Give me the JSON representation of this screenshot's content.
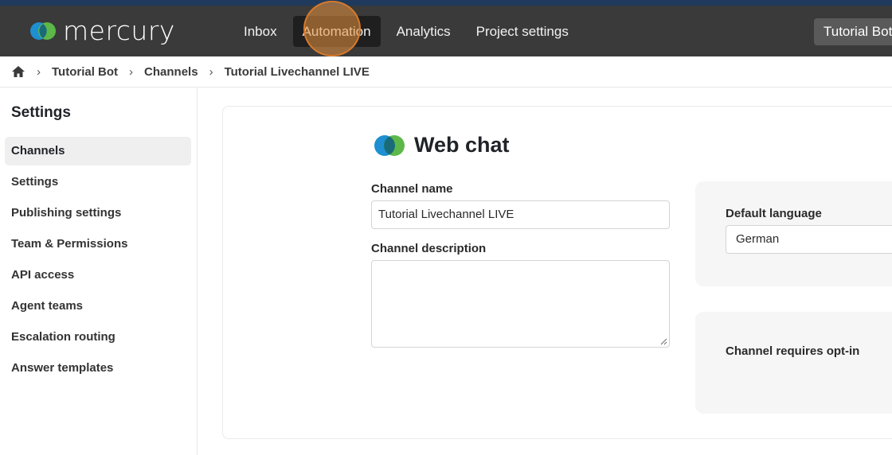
{
  "app": {
    "logo_text": "mercury"
  },
  "nav": {
    "items": [
      {
        "label": "Inbox",
        "active": false
      },
      {
        "label": "Automation",
        "active": true
      },
      {
        "label": "Analytics",
        "active": false
      },
      {
        "label": "Project settings",
        "active": false
      }
    ],
    "project_button": "Tutorial Bot"
  },
  "breadcrumb": {
    "home_icon": "home-icon",
    "items": [
      "Tutorial Bot",
      "Channels",
      "Tutorial Livechannel LIVE"
    ]
  },
  "sidebar": {
    "title": "Settings",
    "items": [
      {
        "label": "Channels",
        "active": true
      },
      {
        "label": "Settings"
      },
      {
        "label": "Publishing settings"
      },
      {
        "label": "Team & Permissions"
      },
      {
        "label": "API access"
      },
      {
        "label": "Agent teams"
      },
      {
        "label": "Escalation routing"
      },
      {
        "label": "Answer templates"
      }
    ]
  },
  "channel": {
    "title": "Web chat",
    "name_label": "Channel name",
    "name_value": "Tutorial Livechannel LIVE",
    "description_label": "Channel description",
    "description_value": "",
    "default_language_label": "Default language",
    "default_language_value": "German",
    "opt_in_label": "Channel requires opt-in"
  },
  "colors": {
    "topbar": "#3a3a3a",
    "logo_blue": "#1e8fd0",
    "logo_green": "#5db84a",
    "click_highlight": "#e8913c"
  }
}
